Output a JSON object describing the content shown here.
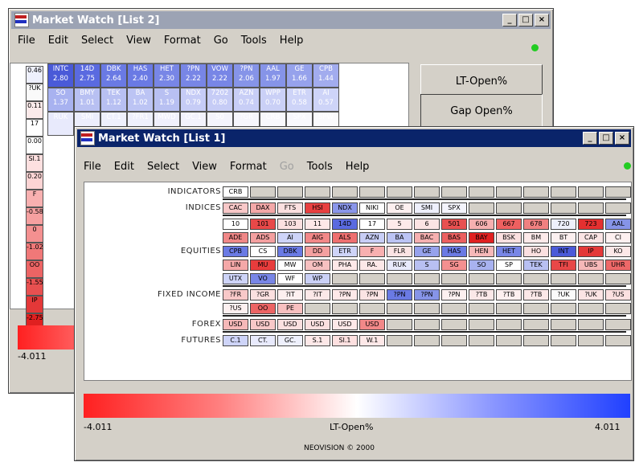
{
  "list2": {
    "title": "Market Watch [List 2]",
    "menu": [
      "File",
      "Edit",
      "Select",
      "View",
      "Format",
      "Go",
      "Tools",
      "Help"
    ],
    "grid_rows": [
      [
        {
          "t": "INTC\n2.80",
          "c": "#4a5ad8"
        },
        {
          "t": "14D\n2.75",
          "c": "#5a6ae0"
        },
        {
          "t": "DBK\n2.64",
          "c": "#6a7ae4"
        },
        {
          "t": "HAS\n2.40",
          "c": "#6a7ae4"
        },
        {
          "t": "HET\n2.30",
          "c": "#7886e6"
        },
        {
          "t": "?PN\n2.22",
          "c": "#7886e6"
        },
        {
          "t": "VOW\n2.22",
          "c": "#7886e6"
        },
        {
          "t": "?PN\n2.06",
          "c": "#8694e8"
        },
        {
          "t": "AAL\n1.97",
          "c": "#8694e8"
        },
        {
          "t": "GE\n1.66",
          "c": "#96a2ec"
        },
        {
          "t": "CPB\n1.44",
          "c": "#a2acee"
        }
      ],
      [
        {
          "t": "SO\n1.37",
          "c": "#a8b2f0"
        },
        {
          "t": "BMY\n1.01",
          "c": "#b8c0f2"
        },
        {
          "t": "TEK\n1.12",
          "c": "#b8c0f2"
        },
        {
          "t": "BA\n1.02",
          "c": "#bcc4f4"
        },
        {
          "t": "S\n1.19",
          "c": "#b8c0f2"
        },
        {
          "t": "NDX\n0.79",
          "c": "#c6ccf6"
        },
        {
          "t": "7202\n0.80",
          "c": "#c6ccf6"
        },
        {
          "t": "AZN\n0.74",
          "c": "#c8cef6"
        },
        {
          "t": "WPP\n0.70",
          "c": "#cad0f6"
        },
        {
          "t": "ETR\n0.58",
          "c": "#ced4f8"
        },
        {
          "t": "AI\n0.57",
          "c": "#ced4f8"
        }
      ],
      [
        {
          "t": "RUK\n",
          "c": "#e8eafc"
        },
        {
          "t": "SMI\n",
          "c": "#eceefc"
        },
        {
          "t": "CT.1\n",
          "c": "#eef0fc"
        },
        {
          "t": "?FR1\n",
          "c": "#eef0fc"
        },
        {
          "t": "MWD\n",
          "c": "#f0f0fc"
        },
        {
          "t": "GC.1\n",
          "c": "#f2f2fc"
        },
        {
          "t": "S0\n",
          "c": "#f4f4fc"
        },
        {
          "t": "?GR\n",
          "c": "#f6f6fc"
        },
        {
          "t": "CRB\n",
          "c": "#f8f8fc"
        },
        {
          "t": "SPX\n",
          "c": "#f8f8fc"
        },
        {
          "t": "SPW\n",
          "c": "#fafafc"
        }
      ]
    ],
    "left_col": [
      {
        "t": "0.46",
        "c": "#eef0fc"
      },
      {
        "t": "?UK",
        "c": "#fafafa"
      },
      {
        "t": "0.11",
        "c": "#fbeaea"
      },
      {
        "t": "17",
        "c": "#ffffff"
      },
      {
        "t": "0.00",
        "c": "#ffffff"
      },
      {
        "t": "SI.1",
        "c": "#fde0e0"
      },
      {
        "t": "0.20",
        "c": "#fcd4d4"
      },
      {
        "t": "F",
        "c": "#f8b0b0"
      },
      {
        "t": "-0.58",
        "c": "#f6a0a0"
      },
      {
        "t": "0",
        "c": "#f49090"
      },
      {
        "t": "-1.02",
        "c": "#f07878"
      },
      {
        "t": "OO",
        "c": "#ec6464"
      },
      {
        "t": "-1.55",
        "c": "#e85050"
      },
      {
        "t": "IP",
        "c": "#e43838"
      },
      {
        "t": "-2.75",
        "c": "#e02020"
      }
    ],
    "buttons": [
      "LT-Open%",
      "Gap Open%"
    ],
    "scale_min": "-4.011"
  },
  "list1": {
    "title": "Market Watch [List 1]",
    "menu": [
      "File",
      "Edit",
      "Select",
      "View",
      "Format",
      "Go",
      "Tools",
      "Help"
    ],
    "disabled_menu_index": 5,
    "rows": [
      {
        "label": "INDICATORS",
        "cells": [
          {
            "t": "CRB",
            "c": "#ffffff"
          }
        ],
        "sep_after": true
      },
      {
        "label": "INDICES",
        "cells": [
          {
            "t": "CAC",
            "c": "#f8c8c8"
          },
          {
            "t": "DAX",
            "c": "#f4a8a8"
          },
          {
            "t": "FTS",
            "c": "#fbe0e0"
          },
          {
            "t": "HSI",
            "c": "#e84040"
          },
          {
            "t": "NDX",
            "c": "#8a96ea"
          },
          {
            "t": "NIKI",
            "c": "#ffffff"
          },
          {
            "t": "OE",
            "c": "#fdf0f0"
          },
          {
            "t": "SMI",
            "c": "#eef0fc"
          },
          {
            "t": "SPX",
            "c": "#f4f4fc"
          }
        ],
        "sep_after": true
      },
      {
        "label": "",
        "cells": [
          {
            "t": "10",
            "c": "#ffffff"
          },
          {
            "t": "101",
            "c": "#e84848"
          },
          {
            "t": "103",
            "c": "#fbe0e0"
          },
          {
            "t": "11",
            "c": "#fde8e8"
          },
          {
            "t": "14D",
            "c": "#5a6ae0"
          },
          {
            "t": "17",
            "c": "#ffffff"
          },
          {
            "t": "5",
            "c": "#fdeaea"
          },
          {
            "t": "6",
            "c": "#fbe4e4"
          },
          {
            "t": "501",
            "c": "#e85050"
          },
          {
            "t": "606",
            "c": "#f6b0b0"
          },
          {
            "t": "667",
            "c": "#ee6060"
          },
          {
            "t": "678",
            "c": "#f08080"
          },
          {
            "t": "720",
            "c": "#eef0fc"
          },
          {
            "t": "723",
            "c": "#e43030"
          },
          {
            "t": "AAL",
            "c": "#8694e8"
          }
        ]
      },
      {
        "label": "",
        "cells": [
          {
            "t": "ADE",
            "c": "#f08888"
          },
          {
            "t": "ADS",
            "c": "#f4a0a0"
          },
          {
            "t": "AI",
            "c": "#ced4f8"
          },
          {
            "t": "AIG",
            "c": "#f28888"
          },
          {
            "t": "ALS",
            "c": "#ee7070"
          },
          {
            "t": "AZN",
            "c": "#c8cef6"
          },
          {
            "t": "BA",
            "c": "#bcc4f4"
          },
          {
            "t": "BAC",
            "c": "#f6b0b0"
          },
          {
            "t": "BAS",
            "c": "#ec6060"
          },
          {
            "t": "BAY",
            "c": "#e02020"
          },
          {
            "t": "BSK",
            "c": "#fbe0e0"
          },
          {
            "t": "BM",
            "c": "#fdeaea"
          },
          {
            "t": "BT",
            "c": "#fcf0f0"
          },
          {
            "t": "CAP",
            "c": "#fbe4e4"
          },
          {
            "t": "CI",
            "c": "#fdf0f0"
          }
        ]
      },
      {
        "label": "EQUITIES",
        "cells": [
          {
            "t": "CPB",
            "c": "#6a7ae4"
          },
          {
            "t": "CS",
            "c": "#ffffff"
          },
          {
            "t": "DBK",
            "c": "#6a7ae4"
          },
          {
            "t": "DD",
            "c": "#f4a0a0"
          },
          {
            "t": "ETR",
            "c": "#ced4f8"
          },
          {
            "t": "F",
            "c": "#f8b0b0"
          },
          {
            "t": "FLR",
            "c": "#fbe4e4"
          },
          {
            "t": "GE",
            "c": "#96a2ec"
          },
          {
            "t": "HAS",
            "c": "#6a7ae4"
          },
          {
            "t": "HEN",
            "c": "#f6b8b8"
          },
          {
            "t": "HET",
            "c": "#7886e6"
          },
          {
            "t": "HO",
            "c": "#fbe0e0"
          },
          {
            "t": "INT",
            "c": "#4a5ad8"
          },
          {
            "t": "IP",
            "c": "#e43838"
          },
          {
            "t": "KO",
            "c": "#fce8e8"
          }
        ]
      },
      {
        "label": "",
        "cells": [
          {
            "t": "LIN",
            "c": "#f4a8a8"
          },
          {
            "t": "MU",
            "c": "#e83c3c"
          },
          {
            "t": "MW",
            "c": "#ffffff"
          },
          {
            "t": "OM",
            "c": "#f6c0c0"
          },
          {
            "t": "PHA",
            "c": "#fde8e8"
          },
          {
            "t": "RA.",
            "c": "#fce8e8"
          },
          {
            "t": "RUK",
            "c": "#e8eafc"
          },
          {
            "t": "S",
            "c": "#b8c0f2"
          },
          {
            "t": "SG",
            "c": "#f49090"
          },
          {
            "t": "SO",
            "c": "#a8b2f0"
          },
          {
            "t": "SP",
            "c": "#ffffff"
          },
          {
            "t": "TEK",
            "c": "#b8c0f2"
          },
          {
            "t": "TFI",
            "c": "#e84848"
          },
          {
            "t": "UBS",
            "c": "#f6b8b8"
          },
          {
            "t": "UHR",
            "c": "#ee6868"
          }
        ]
      },
      {
        "label": "",
        "cells": [
          {
            "t": "UTX",
            "c": "#ced4f8"
          },
          {
            "t": "VO",
            "c": "#7886e6"
          },
          {
            "t": "WF",
            "c": "#ffffff"
          },
          {
            "t": "WP",
            "c": "#cad0f6"
          }
        ],
        "sep_after": true
      },
      {
        "label": "FIXED INCOME",
        "cells": [
          {
            "t": "?FR",
            "c": "#f8c8c8"
          },
          {
            "t": "?GR",
            "c": "#fbe0e0"
          },
          {
            "t": "?IT",
            "c": "#fdf0f0"
          },
          {
            "t": "?IT",
            "c": "#fbe8e8"
          },
          {
            "t": "?PN",
            "c": "#fde8e8"
          },
          {
            "t": "?PN",
            "c": "#fbe4e4"
          },
          {
            "t": "?PN",
            "c": "#6a7ae4"
          },
          {
            "t": "?PN",
            "c": "#8694e8"
          },
          {
            "t": "?PN",
            "c": "#fdf0f0"
          },
          {
            "t": "?TB",
            "c": "#fbe8e8"
          },
          {
            "t": "?TB",
            "c": "#fdf0f0"
          },
          {
            "t": "?TB",
            "c": "#fbe8e8"
          },
          {
            "t": "?UK",
            "c": "#fafafa"
          },
          {
            "t": "?UK",
            "c": "#fbe4e4"
          },
          {
            "t": "?US",
            "c": "#fbe0e0"
          }
        ]
      },
      {
        "label": "",
        "cells": [
          {
            "t": "?US",
            "c": "#fdf0f0"
          },
          {
            "t": "OO",
            "c": "#ec6464"
          },
          {
            "t": "PE",
            "c": "#f8c0c0"
          }
        ],
        "sep_after": true
      },
      {
        "label": "FOREX",
        "cells": [
          {
            "t": "USD",
            "c": "#f6b8b8"
          },
          {
            "t": "USD",
            "c": "#f8c8c8"
          },
          {
            "t": "USD",
            "c": "#fbe0e0"
          },
          {
            "t": "USD",
            "c": "#fbe0e0"
          },
          {
            "t": "USD",
            "c": "#fde8e8"
          },
          {
            "t": "USD",
            "c": "#f28888"
          }
        ],
        "sep_after": true
      },
      {
        "label": "FUTURES",
        "cells": [
          {
            "t": "C.1",
            "c": "#ced4f8"
          },
          {
            "t": "CT.",
            "c": "#e8eafc"
          },
          {
            "t": "GC.",
            "c": "#eef0fc"
          },
          {
            "t": "S.1",
            "c": "#fde8e8"
          },
          {
            "t": "SI.1",
            "c": "#fde0e0"
          },
          {
            "t": "W.1",
            "c": "#fde8e8"
          }
        ]
      }
    ],
    "scale_min": "-4.011",
    "scale_label": "LT-Open%",
    "scale_max": "4.011",
    "footer": "NEOVISION © 2000"
  }
}
